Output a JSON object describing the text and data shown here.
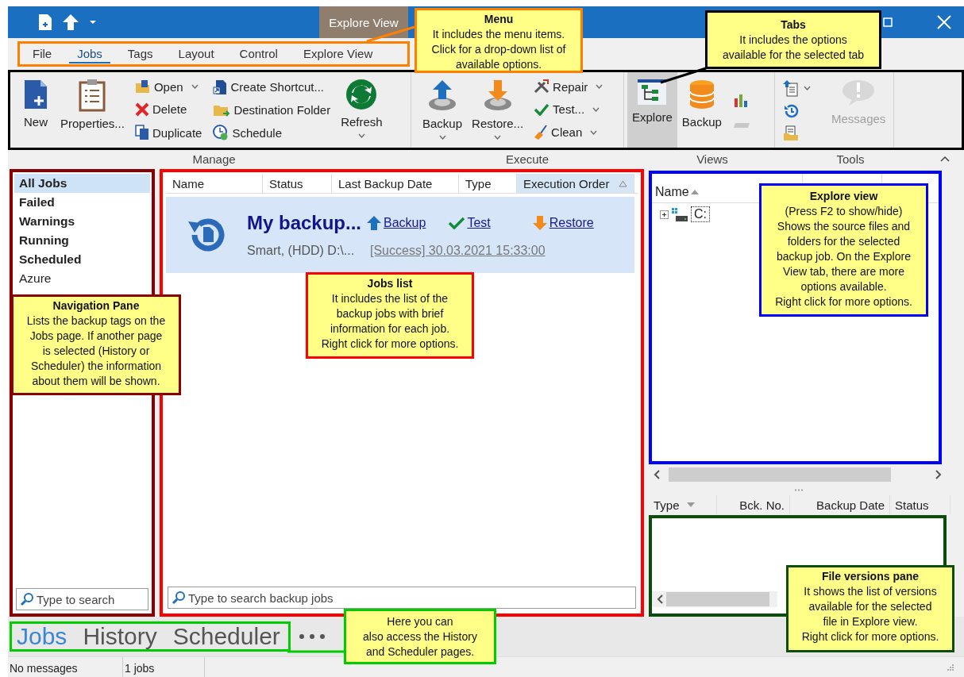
{
  "title_bar": {
    "context_tab": "Explore View"
  },
  "menu": [
    {
      "label": "File",
      "selected": false
    },
    {
      "label": "Jobs",
      "selected": true
    },
    {
      "label": "Tags",
      "selected": false
    },
    {
      "label": "Layout",
      "selected": false
    },
    {
      "label": "Control",
      "selected": false
    },
    {
      "label": "Explore View",
      "selected": false
    }
  ],
  "ribbon": {
    "manage": {
      "label": "Manage",
      "new": "New",
      "properties": "Properties...",
      "open": "Open",
      "delete": "Delete",
      "duplicate": "Duplicate",
      "create_shortcut": "Create Shortcut...",
      "destination_folder": "Destination Folder",
      "schedule": "Schedule",
      "refresh": "Refresh"
    },
    "execute": {
      "label": "Execute",
      "backup": "Backup",
      "restore": "Restore...",
      "repair": "Repair",
      "test": "Test...",
      "clean": "Clean"
    },
    "views": {
      "label": "Views",
      "explore": {
        "label": "Explore",
        "selected": true
      },
      "backup": {
        "label": "Backup",
        "selected": false
      }
    },
    "tools": {
      "label": "Tools",
      "messages": {
        "label": "Messages",
        "disabled": true
      }
    }
  },
  "navigation": {
    "items": [
      {
        "label": "All Jobs",
        "kind": "filter",
        "selected": true
      },
      {
        "label": "Failed",
        "kind": "filter",
        "selected": false
      },
      {
        "label": "Warnings",
        "kind": "filter",
        "selected": false
      },
      {
        "label": "Running",
        "kind": "filter",
        "selected": false
      },
      {
        "label": "Scheduled",
        "kind": "filter",
        "selected": false
      },
      {
        "label": "Azure",
        "kind": "tag",
        "selected": false
      }
    ],
    "search": {
      "placeholder": "Type to search"
    }
  },
  "jobs": {
    "columns": [
      {
        "label": "Name",
        "sorted": false
      },
      {
        "label": "Status",
        "sorted": false
      },
      {
        "label": "Last Backup Date",
        "sorted": false
      },
      {
        "label": "Type",
        "sorted": false
      },
      {
        "label": "Execution Order",
        "sorted": true
      }
    ],
    "rows": [
      {
        "name": "My backup...",
        "details": "Smart, (HDD) D:\\...",
        "last_result": "[Success] 30.03.2021 15:33:00",
        "selected": true,
        "actions": {
          "backup": "Backup",
          "test": "Test",
          "restore": "Restore"
        }
      }
    ],
    "search": {
      "placeholder": "Type to search backup jobs"
    }
  },
  "explore": {
    "columns": [
      {
        "label": "Name",
        "sorted": true
      }
    ],
    "tree": [
      {
        "label": "C:",
        "expanded": false
      }
    ]
  },
  "versions": {
    "columns": [
      {
        "label": "Type",
        "sorted": true
      },
      {
        "label": "Bck. No.",
        "sorted": false
      },
      {
        "label": "Backup Date",
        "sorted": false
      },
      {
        "label": "Status",
        "sorted": false
      }
    ]
  },
  "pages": [
    {
      "label": "Jobs",
      "selected": true
    },
    {
      "label": "History",
      "selected": false
    },
    {
      "label": "Scheduler",
      "selected": false
    }
  ],
  "status_bar": [
    "No messages",
    "1 jobs"
  ],
  "callouts": [
    {
      "title": "Menu",
      "lines": [
        "It includes the menu items.",
        "Click for a drop-down list of",
        "available options."
      ],
      "color": "#ff8000"
    },
    {
      "title": "Tabs",
      "lines": [
        "It includes the options",
        "available for the selected tab"
      ],
      "color": "#000000"
    },
    {
      "title": "Navigation Pane",
      "lines": [
        "Lists the backup tags on the",
        "Jobs page. If another page",
        "is selected (History or",
        "Scheduler) the information",
        "about them will be shown."
      ],
      "color": "#8b0000"
    },
    {
      "title": "Jobs list",
      "lines": [
        "It includes the list of the",
        "backup jobs with brief",
        "information for each job.",
        "Right click for more options."
      ],
      "color": "#ff0000"
    },
    {
      "title": "Explore view",
      "lines": [
        "(Press F2 to show/hide)",
        "Shows the source files and",
        "folders for the selected",
        "backup job. On the Explore",
        "View tab, there are more",
        "options available.",
        "Right click for more options."
      ],
      "color": "#0000ff"
    },
    {
      "lines": [
        "Here you can",
        "also access the History",
        "and Scheduler pages."
      ],
      "color": "#00cc00"
    },
    {
      "title": "File versions pane",
      "lines": [
        "It shows the list of versions",
        "available for the selected",
        "file in Explore view.",
        "Right click for more options."
      ],
      "color": "#0b4d0b"
    }
  ]
}
